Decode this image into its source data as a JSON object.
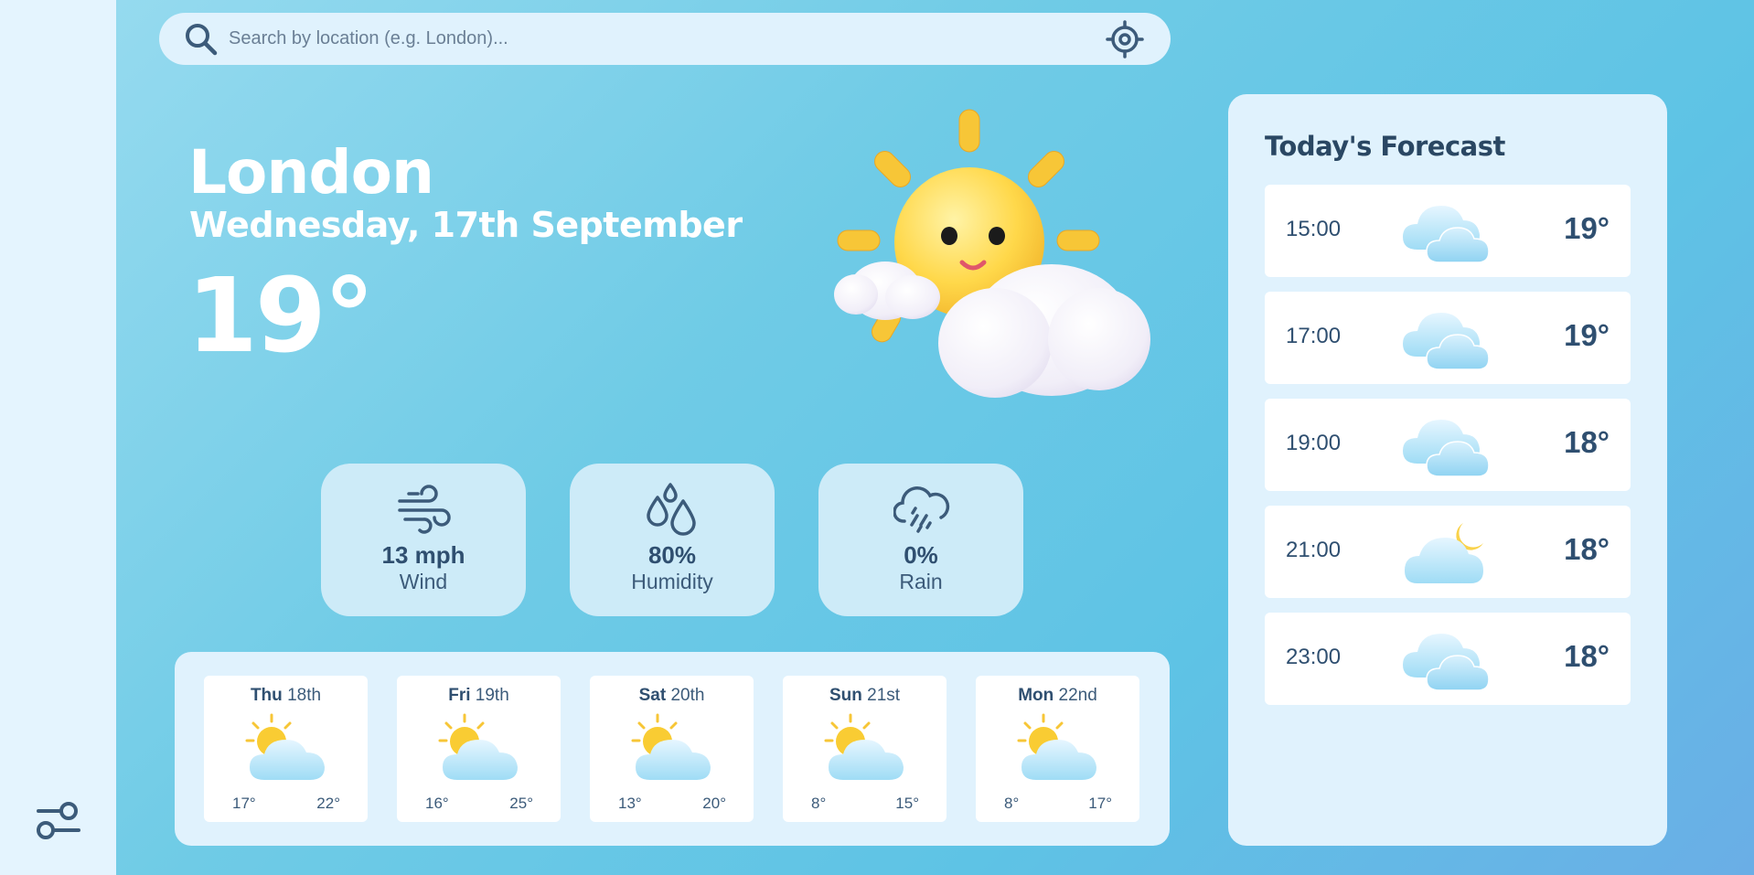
{
  "search": {
    "placeholder": "Search by location (e.g. London)..."
  },
  "current": {
    "city": "London",
    "date": "Wednesday, 17th September",
    "temperature": "19°",
    "icon": "sun-behind-clouds-icon"
  },
  "stats": [
    {
      "icon": "wind-icon",
      "value": "13 mph",
      "label": "Wind"
    },
    {
      "icon": "humidity-icon",
      "value": "80%",
      "label": "Humidity"
    },
    {
      "icon": "rain-icon",
      "value": "0%",
      "label": "Rain"
    }
  ],
  "weekly": [
    {
      "day": "Thu",
      "date": "18th",
      "low": "17°",
      "high": "22°",
      "icon": "partly-sunny-icon"
    },
    {
      "day": "Fri",
      "date": "19th",
      "low": "16°",
      "high": "25°",
      "icon": "partly-sunny-icon"
    },
    {
      "day": "Sat",
      "date": "20th",
      "low": "13°",
      "high": "20°",
      "icon": "partly-sunny-icon"
    },
    {
      "day": "Sun",
      "date": "21st",
      "low": "8°",
      "high": "15°",
      "icon": "partly-sunny-icon"
    },
    {
      "day": "Mon",
      "date": "22nd",
      "low": "8°",
      "high": "17°",
      "icon": "partly-sunny-icon"
    }
  ],
  "forecast": {
    "title": "Today's Forecast",
    "hours": [
      {
        "time": "15:00",
        "temp": "19°",
        "icon": "cloudy-icon"
      },
      {
        "time": "17:00",
        "temp": "19°",
        "icon": "cloudy-icon"
      },
      {
        "time": "19:00",
        "temp": "18°",
        "icon": "cloudy-icon"
      },
      {
        "time": "21:00",
        "temp": "18°",
        "icon": "night-cloudy-icon"
      },
      {
        "time": "23:00",
        "temp": "18°",
        "icon": "cloudy-icon"
      }
    ]
  },
  "colors": {
    "accent_text": "#2f4f70",
    "panel": "#e0f2fd",
    "sidebar": "#e4f4fe",
    "stat_card": "#cdebf8"
  }
}
